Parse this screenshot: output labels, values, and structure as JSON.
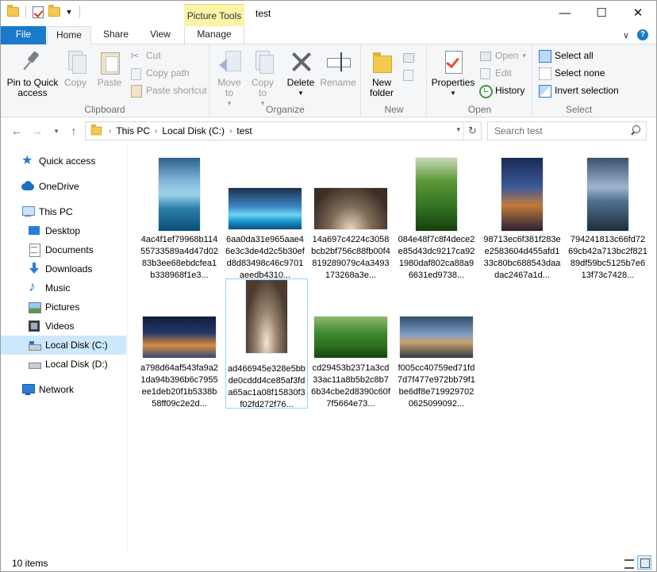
{
  "window": {
    "title": "test",
    "context_tab_group": "Picture Tools",
    "minimize": "—",
    "maximize": "☐",
    "close": "✕"
  },
  "ribbon_tabs": {
    "file": "File",
    "home": "Home",
    "share": "Share",
    "view": "View",
    "manage": "Manage"
  },
  "help": {
    "expand": "∨",
    "help": "?"
  },
  "clipboard": {
    "label": "Clipboard",
    "pin": "Pin to Quick access",
    "copy": "Copy",
    "paste": "Paste",
    "cut": "Cut",
    "copy_path": "Copy path",
    "paste_shortcut": "Paste shortcut"
  },
  "organize": {
    "label": "Organize",
    "move_to": "Move to",
    "copy_to": "Copy to",
    "delete": "Delete",
    "rename": "Rename"
  },
  "new": {
    "label": "New",
    "new_folder": "New folder"
  },
  "open": {
    "label": "Open",
    "properties": "Properties",
    "open": "Open",
    "edit": "Edit",
    "history": "History"
  },
  "select": {
    "label": "Select",
    "select_all": "Select all",
    "select_none": "Select none",
    "invert_selection": "Invert selection"
  },
  "address": {
    "crumbs": [
      "This PC",
      "Local Disk (C:)",
      "test"
    ],
    "search_placeholder": "Search test"
  },
  "nav_pane": {
    "quick_access": "Quick access",
    "onedrive": "OneDrive",
    "this_pc": "This PC",
    "desktop": "Desktop",
    "documents": "Documents",
    "downloads": "Downloads",
    "music": "Music",
    "pictures": "Pictures",
    "videos": "Videos",
    "local_c": "Local Disk (C:)",
    "local_d": "Local Disk (D:)",
    "network": "Network"
  },
  "files": [
    {
      "name": "4ac4f1ef79968b11455733589a4d47d0283b3ee68ebdcfea1b338968f1e3...",
      "orientation": "portrait",
      "image": "lake-boardwalk"
    },
    {
      "name": "6aa0da31e965aae46e3c3de4d2c5b30efd8d83498c46c9701aeedb4310...",
      "orientation": "landscape",
      "image": "beach-sunset"
    },
    {
      "name": "14a697c4224c3058bcb2bf756c88fb00f4819289079c4a3493173268a3e...",
      "orientation": "landscape",
      "image": "cathedral-arches"
    },
    {
      "name": "084e48f7c8f4dece2e85d43dc9217ca921980daf802ca88a96631ed9738...",
      "orientation": "portrait",
      "image": "green-hills"
    },
    {
      "name": "98713ec6f381f283ee2583604d455afd133c80bc688543daadac2467a1d...",
      "orientation": "portrait",
      "image": "coastal-village-night"
    },
    {
      "name": "794241813c66fd7269cb42a713bc2f82189df59bc5125b7e613f73c7428...",
      "orientation": "portrait",
      "image": "lake-rocks"
    },
    {
      "name": "a798d64af543fa9a21da94b396b6c7955ee1deb20f1b5338b58ff09c2e2d...",
      "orientation": "landscape",
      "image": "cinque-terre"
    },
    {
      "name": "ad466945e328e5bbde0cddd4ce85af3fda65ac1a08f15830f3f02fd272f76...",
      "orientation": "portrait",
      "image": "gothic-vault"
    },
    {
      "name": "cd29453b2371a3cd33ac11a8b5b2c8b76b34cbe2d8390c60f7f5664e73...",
      "orientation": "landscape",
      "image": "tea-terraces"
    },
    {
      "name": "f005cc40759ed71fd7d7f477e972bb79f1be6df8e7199297020625099092...",
      "orientation": "landscape",
      "image": "lake-stones"
    }
  ],
  "status": {
    "item_count": "10 items"
  }
}
